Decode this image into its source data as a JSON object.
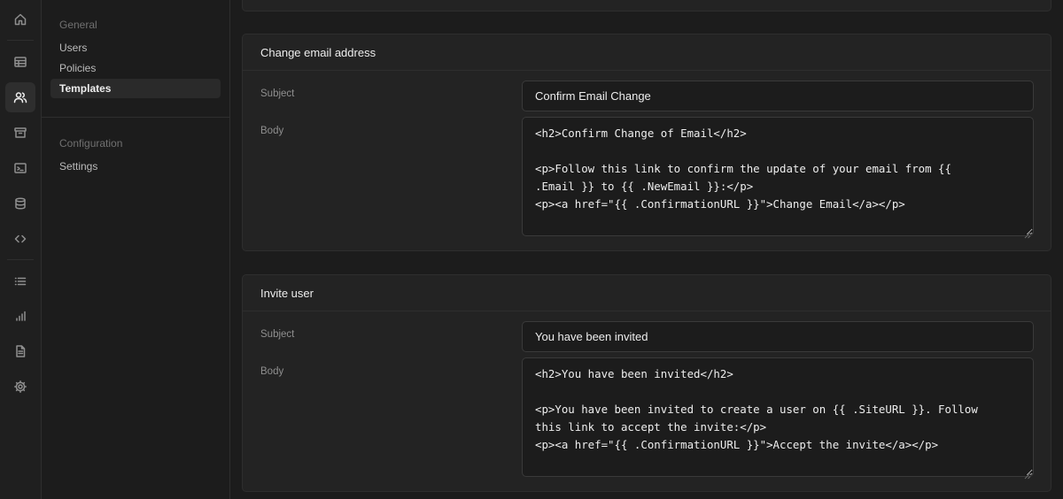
{
  "rail": {
    "icons": [
      "home-icon",
      "table-icon",
      "users-icon",
      "archive-icon",
      "terminal-icon",
      "database-icon",
      "code-icon",
      "list-icon",
      "bar-chart-icon",
      "document-icon",
      "gear-icon"
    ],
    "active": "users-icon"
  },
  "menu": {
    "general_title": "General",
    "general_items": [
      "Users",
      "Policies",
      "Templates"
    ],
    "active_item": "Templates",
    "configuration_title": "Configuration",
    "configuration_items": [
      "Settings"
    ]
  },
  "cards": [
    {
      "title": "Change email address",
      "subject_label": "Subject",
      "subject_value": "Confirm Email Change",
      "body_label": "Body",
      "body_value": "<h2>Confirm Change of Email</h2>\n\n<p>Follow this link to confirm the update of your email from {{\n.Email }} to {{ .NewEmail }}:</p>\n<p><a href=\"{{ .ConfirmationURL }}\">Change Email</a></p>"
    },
    {
      "title": "Invite user",
      "subject_label": "Subject",
      "subject_value": "You have been invited",
      "body_label": "Body",
      "body_value": "<h2>You have been invited</h2>\n\n<p>You have been invited to create a user on {{ .SiteURL }}. Follow\nthis link to accept the invite:</p>\n<p><a href=\"{{ .ConfirmationURL }}\">Accept the invite</a></p>"
    }
  ],
  "colors": {
    "background": "#1c1c1c",
    "card": "#232323",
    "border": "#2e2e2e",
    "text": "#ededed",
    "muted": "#8f8f8f"
  }
}
